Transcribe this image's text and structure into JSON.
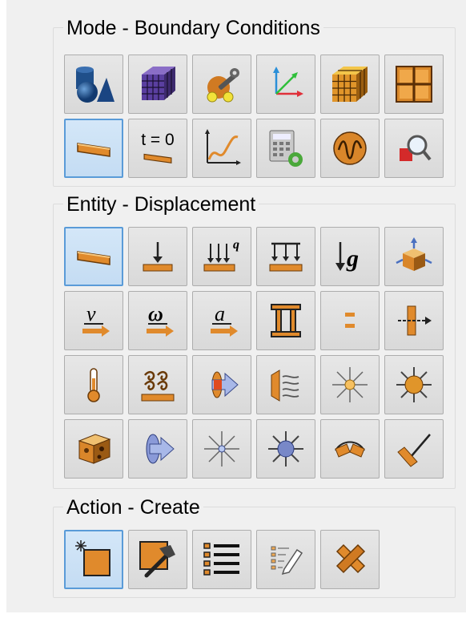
{
  "groups": [
    {
      "title": "Mode - Boundary Conditions",
      "buttons": [
        {
          "icon": "geometry-icon",
          "selected": false
        },
        {
          "icon": "mesh-icon",
          "selected": false
        },
        {
          "icon": "tools-icon",
          "selected": false
        },
        {
          "icon": "coordinate-system-icon",
          "selected": false
        },
        {
          "icon": "hex-mesh-icon",
          "selected": false
        },
        {
          "icon": "grid-partition-icon",
          "selected": false
        },
        {
          "icon": "boundary-condition-icon",
          "selected": true
        },
        {
          "icon": "initial-condition-icon",
          "selected": false,
          "text": "t = 0"
        },
        {
          "icon": "function-curve-icon",
          "selected": false
        },
        {
          "icon": "calculator-icon",
          "selected": false
        },
        {
          "icon": "oscillation-icon",
          "selected": false
        },
        {
          "icon": "inspect-icon",
          "selected": false
        }
      ]
    },
    {
      "title": "Entity - Displacement",
      "buttons": [
        {
          "icon": "displacement-icon",
          "selected": true
        },
        {
          "icon": "force-icon",
          "selected": false
        },
        {
          "icon": "pressure-icon",
          "selected": false,
          "text": "q"
        },
        {
          "icon": "distributed-load-icon",
          "selected": false
        },
        {
          "icon": "gravity-icon",
          "selected": false,
          "text": "g"
        },
        {
          "icon": "rigid-body-icon",
          "selected": false
        },
        {
          "icon": "velocity-icon",
          "selected": false,
          "text": "ν"
        },
        {
          "icon": "angular-velocity-icon",
          "selected": false,
          "text": "ω"
        },
        {
          "icon": "acceleration-icon",
          "selected": false,
          "text": "a"
        },
        {
          "icon": "contact-pair-icon",
          "selected": false
        },
        {
          "icon": "gap-icon",
          "selected": false
        },
        {
          "icon": "bolt-load-icon",
          "selected": false
        },
        {
          "icon": "temperature-icon",
          "selected": false
        },
        {
          "icon": "convection-icon",
          "selected": false
        },
        {
          "icon": "heat-flux-icon",
          "selected": false
        },
        {
          "icon": "radiation-icon",
          "selected": false
        },
        {
          "icon": "light-source-icon",
          "selected": false
        },
        {
          "icon": "sun-icon",
          "selected": false
        },
        {
          "icon": "volume-source-icon",
          "selected": false
        },
        {
          "icon": "surface-flux-icon",
          "selected": false
        },
        {
          "icon": "point-source-icon",
          "selected": false
        },
        {
          "icon": "sphere-source-icon",
          "selected": false
        },
        {
          "icon": "hinge-icon",
          "selected": false
        },
        {
          "icon": "support-icon",
          "selected": false
        }
      ]
    },
    {
      "title": "Action - Create",
      "buttons": [
        {
          "icon": "create-new-icon",
          "selected": true
        },
        {
          "icon": "modify-hammer-icon",
          "selected": false
        },
        {
          "icon": "list-icon",
          "selected": false
        },
        {
          "icon": "edit-list-icon",
          "selected": false
        },
        {
          "icon": "delete-icon",
          "selected": false
        }
      ]
    }
  ],
  "colors": {
    "panel": "#f0f0f0",
    "button": "#dedede",
    "button_selected": "#cce4f7",
    "selected_border": "#5a9bd8",
    "orange": "#e08a2c"
  }
}
